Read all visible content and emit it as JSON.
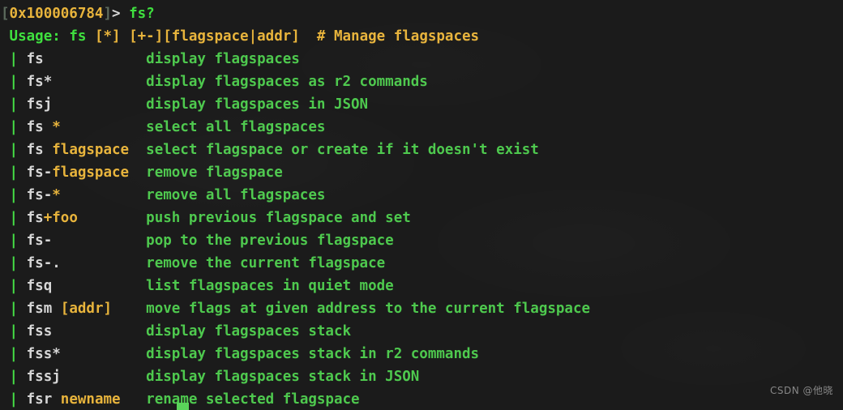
{
  "terminal": {
    "background_color": "#1b1b1b",
    "prompt": {
      "open_bracket": "[",
      "address": "0x100006784",
      "close_bracket": "]",
      "arrow": ">",
      "command": "fs?"
    },
    "usage": {
      "label": "Usage:",
      "command": "fs",
      "args": "[*] [+-][flagspace|addr]",
      "comment": "# Manage flagspaces"
    },
    "colors": {
      "green": "#4ec94e",
      "bright_green": "#46e046",
      "yellow": "#e8b43c",
      "white": "#d6d6d6",
      "bracket_grey": "#5c6a5c"
    },
    "rows": [
      {
        "bullet": "|",
        "cmd": "fs",
        "arg": "",
        "desc": "display flagspaces"
      },
      {
        "bullet": "|",
        "cmd": "fs*",
        "arg": "",
        "desc": "display flagspaces as r2 commands"
      },
      {
        "bullet": "|",
        "cmd": "fsj",
        "arg": "",
        "desc": "display flagspaces in JSON"
      },
      {
        "bullet": "|",
        "cmd": "fs ",
        "arg": "*",
        "desc": "select all flagspaces"
      },
      {
        "bullet": "|",
        "cmd": "fs ",
        "arg": "flagspace",
        "desc": "select flagspace or create if it doesn't exist"
      },
      {
        "bullet": "|",
        "cmd": "fs-",
        "arg": "flagspace",
        "desc": "remove flagspace"
      },
      {
        "bullet": "|",
        "cmd": "fs-",
        "arg": "*",
        "desc": "remove all flagspaces"
      },
      {
        "bullet": "|",
        "cmd": "fs",
        "arg": "+foo",
        "desc": "push previous flagspace and set"
      },
      {
        "bullet": "|",
        "cmd": "fs-",
        "arg": "",
        "desc": "pop to the previous flagspace"
      },
      {
        "bullet": "|",
        "cmd": "fs-.",
        "arg": "",
        "desc": "remove the current flagspace"
      },
      {
        "bullet": "|",
        "cmd": "fsq",
        "arg": "",
        "desc": "list flagspaces in quiet mode"
      },
      {
        "bullet": "|",
        "cmd": "fsm ",
        "arg": "[addr]",
        "desc": "move flags at given address to the current flagspace"
      },
      {
        "bullet": "|",
        "cmd": "fss",
        "arg": "",
        "desc": "display flagspaces stack"
      },
      {
        "bullet": "|",
        "cmd": "fss*",
        "arg": "",
        "desc": "display flagspaces stack in r2 commands"
      },
      {
        "bullet": "|",
        "cmd": "fssj",
        "arg": "",
        "desc": "display flagspaces stack in JSON"
      },
      {
        "bullet": "|",
        "cmd": "fsr ",
        "arg": "newname",
        "desc": "rename selected flagspace"
      }
    ],
    "cursor": {
      "visible": true,
      "color": "#5ad45a"
    },
    "watermark": "CSDN @他晓"
  }
}
